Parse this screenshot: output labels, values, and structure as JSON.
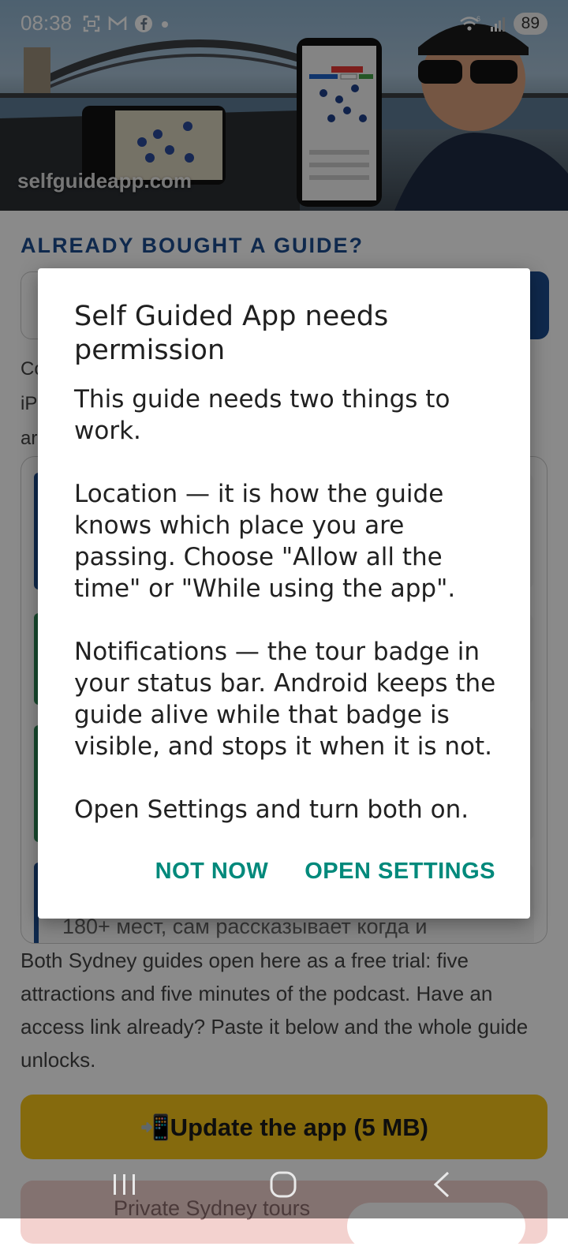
{
  "status_bar": {
    "time": "08:38",
    "battery": "89",
    "left_icons": [
      "screenshot-icon",
      "gmail-icon",
      "facebook-icon",
      "dot-icon"
    ],
    "right_icons": [
      "wifi-icon",
      "signal-icon"
    ]
  },
  "hero": {
    "watermark": "selfguideapp.com"
  },
  "page": {
    "section_title": "ALREADY BOUGHT A GUIDE?",
    "intro_lines": [
      "Co",
      "iP",
      "ar"
    ],
    "guide_snippet": "180+ мест, сам рассказывает когда и",
    "trial_text": "Both Sydney guides open here as a free trial: five attractions and five minutes of the podcast. Have an access link already? Paste it below and the whole guide unlocks.",
    "update_button": "📲Update the app (5 MB)",
    "tours_label": "Private Sydney tours"
  },
  "dialog": {
    "title": "Self Guided App needs permission",
    "paragraph_1": "This guide needs two things to work.",
    "paragraph_2": "Location — it is how the guide knows which place you are passing. Choose \"Allow all the time\" or \"While using the app\".",
    "paragraph_3": "Notifications — the tour badge in your status bar. Android keeps the guide alive while that badge is visible, and stops it when it is not.",
    "paragraph_4": "Open Settings and turn both on.",
    "not_now": "NOT NOW",
    "open_settings": "OPEN SETTINGS"
  },
  "colors": {
    "accent": "#00897b",
    "brand_blue": "#1d4d8f",
    "update_yellow": "#f5c518"
  },
  "nav_bar": {
    "icons": [
      "recents-icon",
      "home-icon",
      "back-icon"
    ]
  }
}
